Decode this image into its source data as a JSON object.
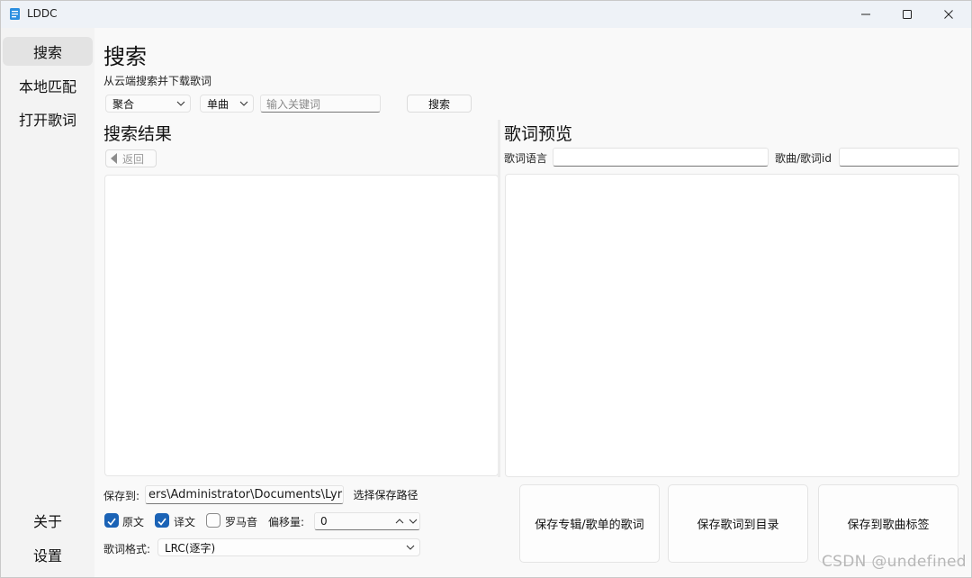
{
  "window": {
    "title": "LDDC"
  },
  "sidebar": {
    "items": [
      {
        "label": "搜索",
        "active": true
      },
      {
        "label": "本地匹配",
        "active": false
      },
      {
        "label": "打开歌词",
        "active": false
      }
    ],
    "bottom_items": [
      {
        "label": "关于"
      },
      {
        "label": "设置"
      }
    ]
  },
  "search_page": {
    "title": "搜索",
    "subtitle": "从云端搜索并下载歌词",
    "source_select": "聚合",
    "type_select": "单曲",
    "keyword_placeholder": "输入关键词",
    "search_button": "搜索"
  },
  "results": {
    "title": "搜索结果",
    "back_button": "返回"
  },
  "preview": {
    "title": "歌词预览",
    "language_label": "歌词语言",
    "language_value": "",
    "id_label": "歌曲/歌词id",
    "id_value": ""
  },
  "save": {
    "save_to_label": "保存到:",
    "save_path": "ers\\Administrator\\Documents\\Lyrics",
    "choose_path_button": "选择保存路径",
    "options": [
      {
        "label": "原文",
        "checked": true
      },
      {
        "label": "译文",
        "checked": true
      },
      {
        "label": "罗马音",
        "checked": false
      }
    ],
    "offset_label": "偏移量:",
    "offset_value": "0",
    "format_label": "歌词格式:",
    "format_value": "LRC(逐字)",
    "save_album_button": "保存专辑/歌单的歌词",
    "save_to_dir_button": "保存歌词到目录",
    "save_to_tag_button": "保存到歌曲标签"
  },
  "watermark": "CSDN @undefined",
  "colors": {
    "accent": "#1b63b6",
    "background": "#f9f9f9",
    "sidebar": "#f3f3f3"
  }
}
